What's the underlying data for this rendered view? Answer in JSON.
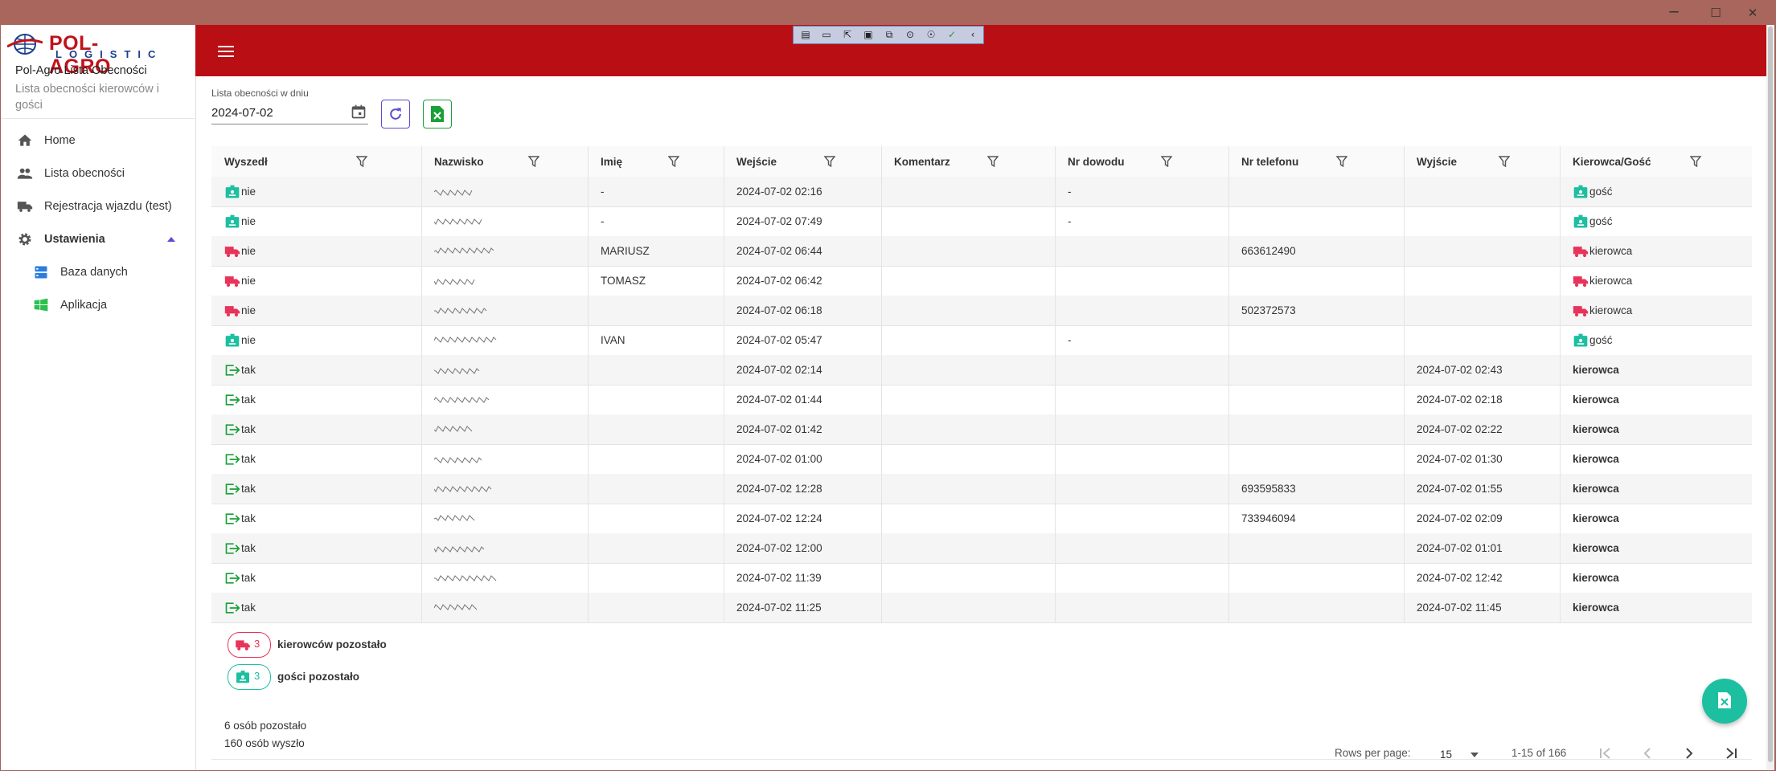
{
  "window": {
    "minimize": "─",
    "maximize": "☐",
    "close": "✕"
  },
  "sidebar": {
    "logo_title": "POL-AGRO",
    "logo_sub": "LOGISTIC",
    "app_title": "Pol-Agro Lista Obecności",
    "app_subtitle": "Lista obecności kierowców i gości",
    "items": [
      {
        "label": "Home",
        "icon": "home-icon"
      },
      {
        "label": "Lista obecności",
        "icon": "people-icon"
      },
      {
        "label": "Rejestracja wjazdu (test)",
        "icon": "truck-icon"
      },
      {
        "label": "Ustawienia",
        "icon": "gear-icon",
        "expanded": true
      },
      {
        "label": "Baza danych",
        "icon": "database-icon"
      },
      {
        "label": "Aplikacja",
        "icon": "windows-icon"
      }
    ]
  },
  "filter": {
    "label": "Lista obecności w dniu",
    "date": "2024-07-02"
  },
  "colors": {
    "accent": "#b90e14",
    "driver": "#e8335a",
    "guest": "#1dbfa1",
    "exit": "#1aa038"
  },
  "table": {
    "columns": [
      "Wyszedł",
      "Nazwisko",
      "Imię",
      "Wejście",
      "Komentarz",
      "Nr dowodu",
      "Nr telefonu",
      "Wyjście",
      "Kierowca/Gość"
    ],
    "rows": [
      {
        "status": "nie",
        "type": "guest",
        "imie": "-",
        "wejscie": "2024-07-02 02:16",
        "komentarz": "",
        "nr_dowodu": "-",
        "telefon": "",
        "wyjscie": "",
        "kg": "gość"
      },
      {
        "status": "nie",
        "type": "guest",
        "imie": "-",
        "wejscie": "2024-07-02 07:49",
        "komentarz": "",
        "nr_dowodu": "-",
        "telefon": "",
        "wyjscie": "",
        "kg": "gość"
      },
      {
        "status": "nie",
        "type": "driver",
        "imie": "MARIUSZ",
        "wejscie": "2024-07-02 06:44",
        "komentarz": "",
        "nr_dowodu": "",
        "telefon": "663612490",
        "wyjscie": "",
        "kg": "kierowca"
      },
      {
        "status": "nie",
        "type": "driver",
        "imie": "TOMASZ",
        "wejscie": "2024-07-02 06:42",
        "komentarz": "",
        "nr_dowodu": "",
        "telefon": "",
        "wyjscie": "",
        "kg": "kierowca"
      },
      {
        "status": "nie",
        "type": "driver",
        "imie": "",
        "wejscie": "2024-07-02 06:18",
        "komentarz": "",
        "nr_dowodu": "",
        "telefon": "502372573",
        "wyjscie": "",
        "kg": "kierowca"
      },
      {
        "status": "nie",
        "type": "guest",
        "imie": "IVAN",
        "wejscie": "2024-07-02 05:47",
        "komentarz": "",
        "nr_dowodu": "-",
        "telefon": "",
        "wyjscie": "",
        "kg": "gość"
      },
      {
        "status": "tak",
        "type": "exit",
        "imie": "",
        "wejscie": "2024-07-02 02:14",
        "komentarz": "",
        "nr_dowodu": "",
        "telefon": "",
        "wyjscie": "2024-07-02 02:43",
        "kg": "kierowca"
      },
      {
        "status": "tak",
        "type": "exit",
        "imie": "",
        "wejscie": "2024-07-02 01:44",
        "komentarz": "",
        "nr_dowodu": "",
        "telefon": "",
        "wyjscie": "2024-07-02 02:18",
        "kg": "kierowca"
      },
      {
        "status": "tak",
        "type": "exit",
        "imie": "",
        "wejscie": "2024-07-02 01:42",
        "komentarz": "",
        "nr_dowodu": "",
        "telefon": "",
        "wyjscie": "2024-07-02 02:22",
        "kg": "kierowca"
      },
      {
        "status": "tak",
        "type": "exit",
        "imie": "",
        "wejscie": "2024-07-02 01:00",
        "komentarz": "",
        "nr_dowodu": "",
        "telefon": "",
        "wyjscie": "2024-07-02 01:30",
        "kg": "kierowca"
      },
      {
        "status": "tak",
        "type": "exit",
        "imie": "",
        "wejscie": "2024-07-02 12:28",
        "komentarz": "",
        "nr_dowodu": "",
        "telefon": "693595833",
        "wyjscie": "2024-07-02 01:55",
        "kg": "kierowca"
      },
      {
        "status": "tak",
        "type": "exit",
        "imie": "",
        "wejscie": "2024-07-02 12:24",
        "komentarz": "",
        "nr_dowodu": "",
        "telefon": "733946094",
        "wyjscie": "2024-07-02 02:09",
        "kg": "kierowca"
      },
      {
        "status": "tak",
        "type": "exit",
        "imie": "",
        "wejscie": "2024-07-02 12:00",
        "komentarz": "",
        "nr_dowodu": "",
        "telefon": "",
        "wyjscie": "2024-07-02 01:01",
        "kg": "kierowca"
      },
      {
        "status": "tak",
        "type": "exit",
        "imie": "",
        "wejscie": "2024-07-02 11:39",
        "komentarz": "",
        "nr_dowodu": "",
        "telefon": "",
        "wyjscie": "2024-07-02 12:42",
        "kg": "kierowca"
      },
      {
        "status": "tak",
        "type": "exit",
        "imie": "",
        "wejscie": "2024-07-02 11:25",
        "komentarz": "",
        "nr_dowodu": "",
        "telefon": "",
        "wyjscie": "2024-07-02 11:45",
        "kg": "kierowca"
      }
    ]
  },
  "summary": {
    "drivers_count": "3",
    "drivers_label": "kierowców pozostało",
    "guests_count": "3",
    "guests_label": "gości pozostało",
    "remaining": "6 osób pozostało",
    "left": "160 osób wyszło"
  },
  "pagination": {
    "rows_per_page_label": "Rows per page:",
    "rows_per_page": "15",
    "range": "1-15 of 166"
  }
}
